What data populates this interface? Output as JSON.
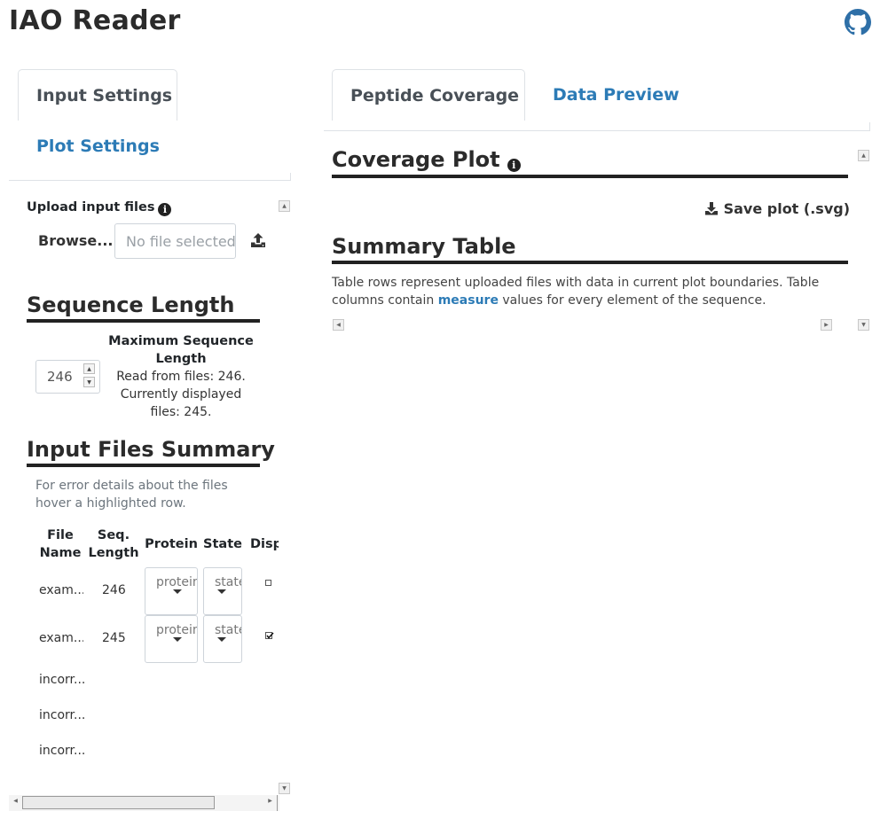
{
  "app": {
    "title": "IAO Reader"
  },
  "left_tabs": [
    {
      "label": "Input Settings",
      "active": true
    },
    {
      "label": "Plot Settings",
      "active": false
    }
  ],
  "right_tabs": [
    {
      "label": "Peptide Coverage",
      "active": true
    },
    {
      "label": "Data Preview",
      "active": false
    }
  ],
  "upload": {
    "label": "Upload input files",
    "browse_label": "Browse...",
    "placeholder": "No file selected"
  },
  "sequence_length": {
    "heading": "Sequence Length",
    "input_value": "246",
    "max_label": "Maximum Sequence Length",
    "read_from_files": "Read from files: 246. Currently displayed files: 245."
  },
  "input_files_summary": {
    "heading": "Input Files Summary",
    "note": "For error details about the files hover a highlighted row.",
    "columns": [
      "File Name",
      "Seq. Length",
      "Protein",
      "State",
      "Disp"
    ],
    "rows": [
      {
        "file_name": "exam...",
        "seq_length": "246",
        "protein": "protein",
        "state": "state",
        "checked": false
      },
      {
        "file_name": "exam...",
        "seq_length": "245",
        "protein": "protein",
        "state": "state",
        "checked": true
      },
      {
        "file_name": "incorr...",
        "seq_length": "",
        "protein": "",
        "state": "",
        "checked": null
      },
      {
        "file_name": "incorr...",
        "seq_length": "",
        "protein": "",
        "state": "",
        "checked": null
      },
      {
        "file_name": "incorr...",
        "seq_length": "",
        "protein": "",
        "state": "",
        "checked": null
      }
    ]
  },
  "coverage_plot": {
    "heading": "Coverage Plot",
    "save_label": "Save plot (.svg)"
  },
  "summary_table": {
    "heading": "Summary Table",
    "desc_before": "Table rows represent uploaded files with data in current plot boundaries. Table columns contain ",
    "desc_link": "measure",
    "desc_after": " values for every element of the sequence."
  },
  "icons": {
    "github": "github-icon",
    "info": "info-icon",
    "upload": "upload-icon",
    "download": "download-icon"
  },
  "colors": {
    "accent": "#2c7bb6",
    "text": "#212529",
    "rule": "#222222"
  }
}
